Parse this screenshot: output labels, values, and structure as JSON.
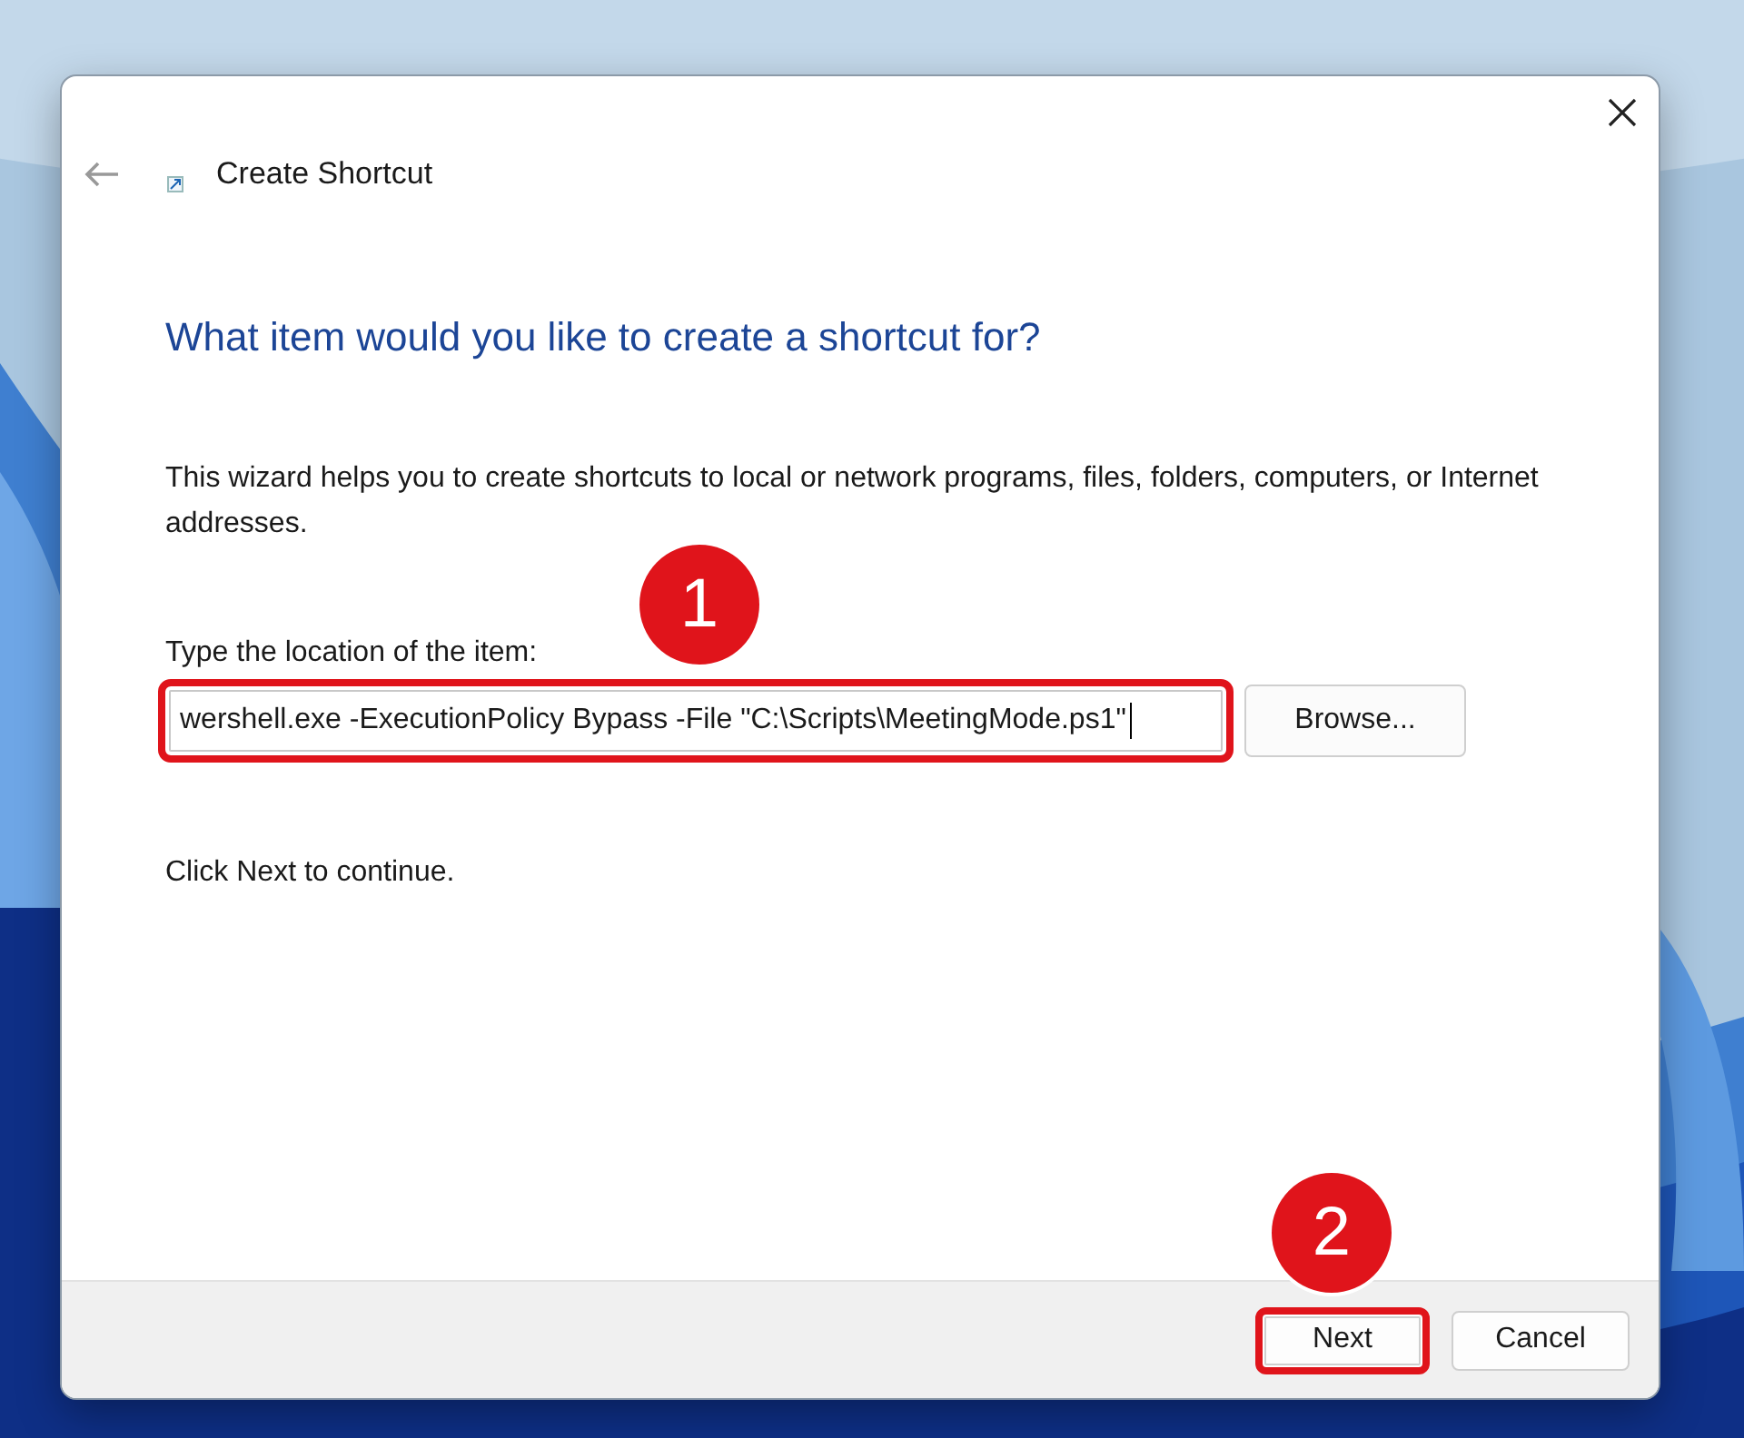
{
  "window": {
    "title": "Create Shortcut"
  },
  "heading": "What item would you like to create a shortcut for?",
  "description": "This wizard helps you to create shortcuts to local or network programs, files, folders, computers, or Internet addresses.",
  "location": {
    "label": "Type the location of the item:",
    "value": "wershell.exe -ExecutionPolicy Bypass -File \"C:\\Scripts\\MeetingMode.ps1\"",
    "button": "Browse..."
  },
  "hint": "Click Next to continue.",
  "buttons": [
    {
      "label": "Next",
      "kind": "primary"
    },
    {
      "label": "Cancel",
      "kind": "secondary"
    }
  ],
  "annotations": [
    {
      "label": "1"
    },
    {
      "label": "2"
    }
  ]
}
